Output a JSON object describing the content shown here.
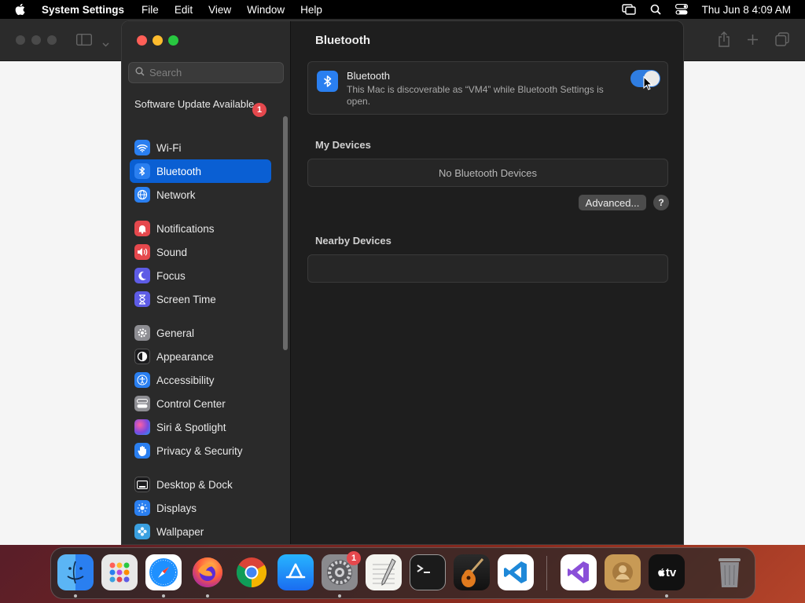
{
  "menubar": {
    "app_name": "System Settings",
    "menus": [
      "File",
      "Edit",
      "View",
      "Window",
      "Help"
    ],
    "clock": "Thu Jun 8  4:09 AM"
  },
  "settings": {
    "search_placeholder": "Search",
    "software_update": {
      "label": "Software Update Available",
      "badge": "1"
    },
    "sidebar_items": [
      {
        "label": "Wi-Fi",
        "icon": "wifi-icon",
        "color": "#2a7ff0"
      },
      {
        "label": "Bluetooth",
        "icon": "bluetooth-icon",
        "color": "#2a7ff0",
        "active": true
      },
      {
        "label": "Network",
        "icon": "globe-icon",
        "color": "#2a7ff0"
      },
      {
        "label": "Notifications",
        "icon": "bell-icon",
        "color": "#e5484d"
      },
      {
        "label": "Sound",
        "icon": "speaker-icon",
        "color": "#e5484d"
      },
      {
        "label": "Focus",
        "icon": "moon-icon",
        "color": "#5e5ce6"
      },
      {
        "label": "Screen Time",
        "icon": "hourglass-icon",
        "color": "#5e5ce6"
      },
      {
        "label": "General",
        "icon": "gear-icon",
        "color": "#8e8e93"
      },
      {
        "label": "Appearance",
        "icon": "appearance-icon",
        "color": "#1c1c1e"
      },
      {
        "label": "Accessibility",
        "icon": "accessibility-icon",
        "color": "#2a7ff0"
      },
      {
        "label": "Control Center",
        "icon": "control-center-icon",
        "color": "#8e8e93"
      },
      {
        "label": "Siri & Spotlight",
        "icon": "siri-icon",
        "color": "#b44ae0"
      },
      {
        "label": "Privacy & Security",
        "icon": "hand-icon",
        "color": "#2a7ff0"
      },
      {
        "label": "Desktop & Dock",
        "icon": "dock-icon",
        "color": "#1c1c1e"
      },
      {
        "label": "Displays",
        "icon": "sun-icon",
        "color": "#2a7ff0"
      },
      {
        "label": "Wallpaper",
        "icon": "flower-icon",
        "color": "#3aa0e0"
      }
    ],
    "content": {
      "title": "Bluetooth",
      "bluetooth_card": {
        "title": "Bluetooth",
        "description": "This Mac is discoverable as “VM4” while Bluetooth Settings is open.",
        "toggle_on": true
      },
      "my_devices_label": "My Devices",
      "no_devices_text": "No Bluetooth Devices",
      "advanced_button": "Advanced...",
      "help_button": "?",
      "nearby_devices_label": "Nearby Devices"
    }
  },
  "dock": {
    "apps": [
      {
        "name": "Finder",
        "icon": "finder-icon",
        "running": true
      },
      {
        "name": "Launchpad",
        "icon": "launchpad-icon",
        "running": false
      },
      {
        "name": "Safari",
        "icon": "safari-icon",
        "running": true
      },
      {
        "name": "Firefox",
        "icon": "firefox-icon",
        "running": true
      },
      {
        "name": "Chrome",
        "icon": "chrome-icon",
        "running": false
      },
      {
        "name": "App Store",
        "icon": "app-store-icon",
        "running": false
      },
      {
        "name": "System Settings",
        "icon": "system-settings-icon",
        "running": true,
        "badge": "1"
      },
      {
        "name": "TextEdit",
        "icon": "textedit-icon",
        "running": false
      },
      {
        "name": "Terminal",
        "icon": "terminal-icon",
        "running": false
      },
      {
        "name": "GarageBand",
        "icon": "garageband-icon",
        "running": false
      },
      {
        "name": "Visual Studio Code",
        "icon": "vscode-icon",
        "running": false
      },
      {
        "name": "Visual Studio",
        "icon": "visual-studio-icon",
        "running": false
      },
      {
        "name": "Contacts",
        "icon": "contacts-icon",
        "running": false
      },
      {
        "name": "Apple TV",
        "icon": "apple-tv-icon",
        "running": true,
        "label": "tv"
      },
      {
        "name": "Trash",
        "icon": "trash-icon",
        "running": false
      }
    ]
  }
}
